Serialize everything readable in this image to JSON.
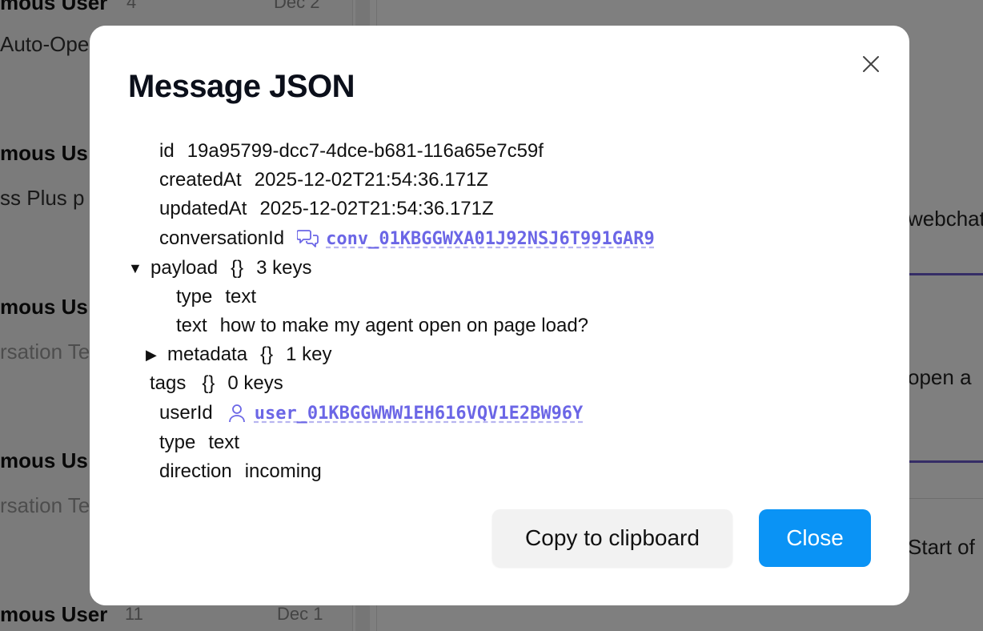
{
  "background": {
    "list": [
      {
        "name": "mous User",
        "count": "4",
        "date": "Dec 2",
        "preview": "Auto-Ope"
      },
      {
        "name": "mous Us",
        "preview": "ss Plus p"
      },
      {
        "name": "mous Us",
        "preview": "rsation Te"
      },
      {
        "name": "mous Us",
        "preview": "rsation Te"
      },
      {
        "name": "mous User",
        "count": "11",
        "date": "Dec 1"
      }
    ],
    "right": [
      "webchat:",
      "open a",
      "Start of"
    ]
  },
  "modal": {
    "title": "Message JSON",
    "close_icon": "close-icon",
    "fields": {
      "id": {
        "key": "id",
        "value": "19a95799-dcc7-4dce-b681-116a65e7c59f"
      },
      "createdAt": {
        "key": "createdAt",
        "value": "2025-12-02T21:54:36.171Z"
      },
      "updatedAt": {
        "key": "updatedAt",
        "value": "2025-12-02T21:54:36.171Z"
      },
      "conversationId": {
        "key": "conversationId",
        "value": "conv_01KBGGWXA01J92NSJ6T991GAR9",
        "icon": "chat-bubbles-icon"
      },
      "payload": {
        "key": "payload",
        "braces": "{}",
        "count": "3 keys",
        "expanded": true,
        "type": {
          "key": "type",
          "value": "text"
        },
        "text": {
          "key": "text",
          "value": "how to make my agent open on page load?"
        },
        "metadata": {
          "key": "metadata",
          "braces": "{}",
          "count": "1 key",
          "expanded": false
        }
      },
      "tags": {
        "key": "tags",
        "braces": "{}",
        "count": "0 keys"
      },
      "userId": {
        "key": "userId",
        "value": "user_01KBGGWWW1EH616VQV1E2BW96Y",
        "icon": "user-icon"
      },
      "type": {
        "key": "type",
        "value": "text"
      },
      "direction": {
        "key": "direction",
        "value": "incoming"
      }
    },
    "buttons": {
      "copy": "Copy to clipboard",
      "close": "Close"
    },
    "colors": {
      "link": "#6b66e6",
      "primary": "#0a93f5"
    }
  }
}
